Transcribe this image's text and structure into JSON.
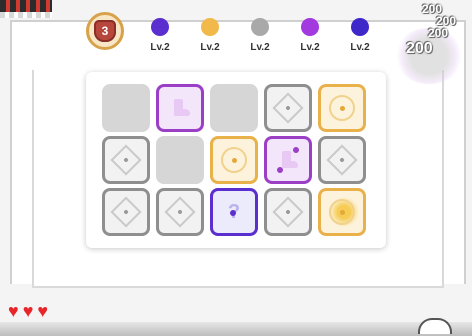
{
  "rank_badge": {
    "value": "3",
    "icon": "rank-shield-icon",
    "color": "#b7473d"
  },
  "levels": [
    {
      "label": "Lv.2",
      "color": "#5b2ecf"
    },
    {
      "label": "Lv.2",
      "color": "#f1b94a"
    },
    {
      "label": "Lv.2",
      "color": "#a9a9a9"
    },
    {
      "label": "Lv.2",
      "color": "#a23ae0"
    },
    {
      "label": "Lv.2",
      "color": "#3f28c9"
    }
  ],
  "score_popups": [
    "200",
    "200",
    "200",
    "200"
  ],
  "board": {
    "rows": [
      [
        {
          "type": "empty"
        },
        {
          "type": "purple",
          "icon": "boot-icon"
        },
        {
          "type": "empty"
        },
        {
          "type": "gray",
          "icon": "diamond-icon"
        },
        {
          "type": "yellow",
          "icon": "ring-icon"
        }
      ],
      [
        {
          "type": "gray",
          "icon": "diamond-icon"
        },
        {
          "type": "empty"
        },
        {
          "type": "yellow",
          "icon": "ring-icon"
        },
        {
          "type": "purple",
          "icon": "boot-icon"
        },
        {
          "type": "gray",
          "icon": "diamond-icon"
        }
      ],
      [
        {
          "type": "gray",
          "icon": "diamond-icon"
        },
        {
          "type": "gray",
          "icon": "diamond-icon"
        },
        {
          "type": "blue",
          "icon": "question-mark-icon"
        },
        {
          "type": "gray",
          "icon": "diamond-icon"
        },
        {
          "type": "yellow",
          "icon": "ring-burst-icon"
        }
      ]
    ]
  },
  "lives": {
    "count": 3,
    "icon": "heart-icon",
    "color": "#e8262a"
  }
}
